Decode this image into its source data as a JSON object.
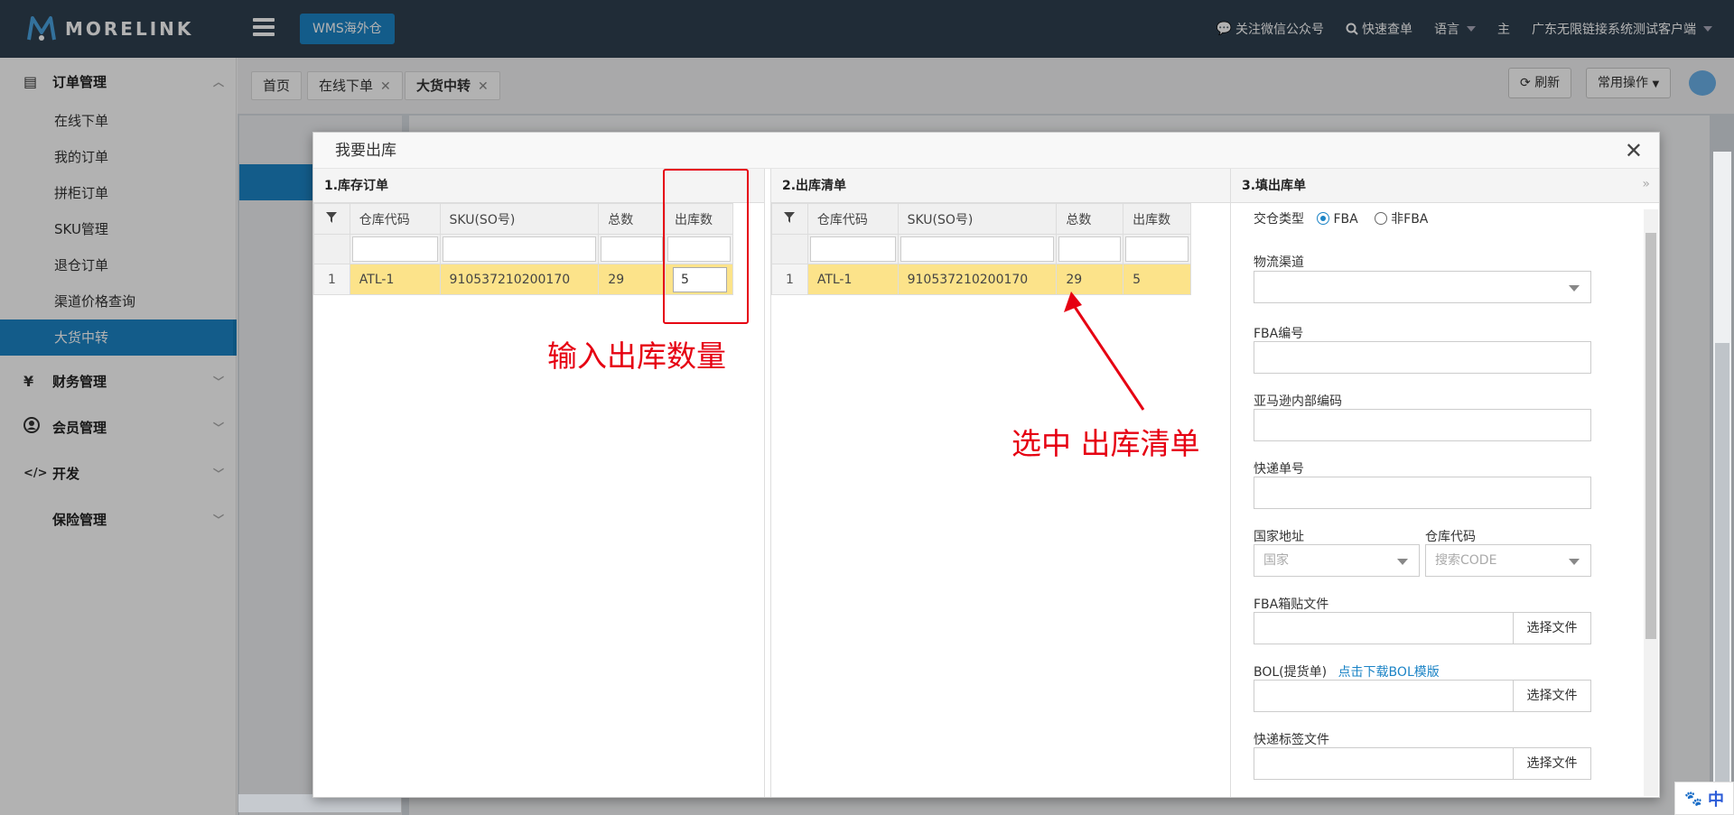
{
  "app": {
    "logo_text": "MORELINK",
    "wms_button": "WMS海外仓"
  },
  "header": {
    "wechat": "关注微信公众号",
    "quick_search": "快速查单",
    "language": "语言",
    "main": "主",
    "company": "广东无限链接系统测试客户端"
  },
  "sidebar": {
    "order_mgmt": "订单管理",
    "items": [
      "在线下单",
      "我的订单",
      "拼柜订单",
      "SKU管理",
      "退仓订单",
      "渠道价格查询",
      "大货中转"
    ],
    "finance_icon": "¥",
    "finance": "财务管理",
    "member": "会员管理",
    "dev_icon": "</>",
    "dev": "开发",
    "insurance": "保险管理"
  },
  "tabs": [
    "首页",
    "在线下单",
    "大货中转"
  ],
  "toolbar": {
    "refresh": "刷新",
    "common_ops": "常用操作"
  },
  "modal": {
    "title": "我要出库",
    "pane1": {
      "title": "1.库存订单",
      "headers": [
        "仓库代码",
        "SKU(SO号)",
        "总数",
        "出库数"
      ],
      "row": {
        "num": "1",
        "warehouse": "ATL-1",
        "sku": "910537210200170",
        "total": "29",
        "qty": "5"
      }
    },
    "pane2": {
      "title": "2.出库清单",
      "headers": [
        "仓库代码",
        "SKU(SO号)",
        "总数",
        "出库数"
      ],
      "row": {
        "num": "1",
        "warehouse": "ATL-1",
        "sku": "910537210200170",
        "total": "29",
        "qty": "5"
      }
    },
    "pane3": {
      "title": "3.填出库单",
      "delivery_type": "交仓类型",
      "opt_fba": "FBA",
      "opt_nonfba": "非FBA",
      "logistics": "物流渠道",
      "fba_no": "FBA编号",
      "amazon_code": "亚马逊内部编码",
      "express_no": "快递单号",
      "country": "国家地址",
      "warehouse_code": "仓库代码",
      "country_ph": "国家",
      "code_ph": "搜索CODE",
      "fba_label_file": "FBA箱贴文件",
      "choose_file": "选择文件",
      "bol": "BOL(提货单)",
      "bol_link": "点击下载BOL模版",
      "express_label": "快递标签文件"
    }
  },
  "annotations": {
    "input_qty": "输入出库数量",
    "select_list": "选中 出库清单"
  },
  "ime": "中",
  "colors": {
    "accent": "#1c84c6",
    "topbar": "#2f4050",
    "highlight": "#fce38a",
    "annotation": "#e60012"
  }
}
